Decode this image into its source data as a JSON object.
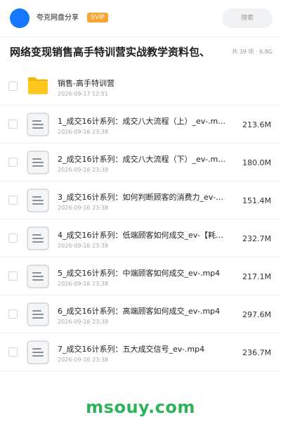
{
  "header": {
    "app_name": "夸克网盘分享",
    "badge": "SVIP",
    "search_label": "搜索"
  },
  "title_bar": {
    "title": "网络变现销售高手特训营实战教学资料包、",
    "meta": "共 39 项 · 6.8G"
  },
  "files": [
    {
      "name": "销售-高手特训营",
      "date": "2026-09-17 12:51",
      "size": "",
      "icon": "folder-icon"
    },
    {
      "name": "1_成交16计系列：成交八大流程（上）_ev-.m…",
      "date": "2026-09-16 23:38",
      "size": "213.6M",
      "icon": "document-icon"
    },
    {
      "name": "2_成交16计系列：成交八大流程（下）_ev-.m…",
      "date": "2026-09-16 23:38",
      "size": "180.0M",
      "icon": "document-icon"
    },
    {
      "name": "3_成交16计系列：如何判断顾客的消费力_ev-【…",
      "date": "2026-09-16 23:38",
      "size": "151.4M",
      "icon": "document-icon"
    },
    {
      "name": "4_成交16计系列：低端顾客如何成交_ev-【耗时…",
      "date": "2026-09-16 23:38",
      "size": "232.7M",
      "icon": "document-icon"
    },
    {
      "name": "5_成交16计系列：中端顾客如何成交_ev-.mp4",
      "date": "2026-09-16 23:38",
      "size": "217.1M",
      "icon": "document-icon"
    },
    {
      "name": "6_成交16计系列：高端顾客如何成交_ev-.mp4",
      "date": "2026-09-16 23:38",
      "size": "297.6M",
      "icon": "document-icon"
    },
    {
      "name": "7_成交16计系列：五大成交信号_ev-.mp4",
      "date": "2026-09-16 23:38",
      "size": "236.7M",
      "icon": "document-icon"
    }
  ],
  "watermark": "msouy.com",
  "colors": {
    "avatar": "#1677ff",
    "svip_badge": "#f7a533",
    "folder": "#ffc71f",
    "watermark": "#2bb35a"
  }
}
